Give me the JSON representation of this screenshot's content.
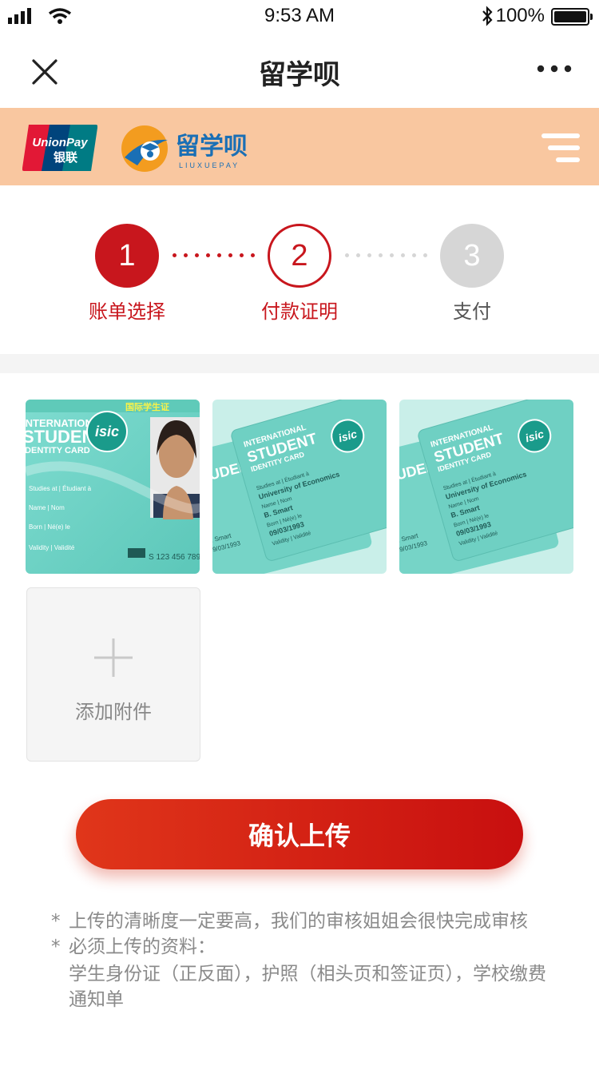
{
  "status_bar": {
    "time": "9:53 AM",
    "battery": "100%",
    "icons": [
      "signal-icon",
      "wifi-icon",
      "bluetooth-icon",
      "battery-icon"
    ]
  },
  "nav": {
    "title": "留学呗",
    "close_icon": "close-icon",
    "more_icon": "more-icon"
  },
  "banner": {
    "color": "#f9c7a0",
    "unionpay_text": "UnionPay",
    "unionpay_cn": "银联",
    "brand_cn": "留学呗",
    "brand_en": "LIUXUEPAY",
    "menu_icon": "menu-icon"
  },
  "steps": [
    {
      "number": "1",
      "label": "账单选择",
      "state": "done"
    },
    {
      "number": "2",
      "label": "付款证明",
      "state": "active"
    },
    {
      "number": "3",
      "label": "支付",
      "state": "pending"
    }
  ],
  "attachments": {
    "images": [
      {
        "alt": "student card front"
      },
      {
        "alt": "student card back"
      },
      {
        "alt": "student card back copy"
      }
    ],
    "card_text": {
      "cn_title": "国际学生证",
      "intl": "INTERNATIONAL",
      "student": "STUDENT",
      "identity": "IDENTITY CARD",
      "isic": "isic",
      "studies": "Studies at | Étudiant à",
      "name": "Name | Nom",
      "born": "Born | Né(e) le",
      "validity": "Validity | Validité",
      "number": "S 123 456 789",
      "university": "University of Economics",
      "holder": "B. Smart",
      "dob": "09/03/1993"
    },
    "add_label": "添加附件"
  },
  "actions": {
    "confirm_label": "确认上传"
  },
  "notes": [
    {
      "star": "*",
      "text": "上传的清晰度一定要高，我们的审核姐姐会很快完成审核"
    },
    {
      "star": "*",
      "text": "必须上传的资料：",
      "detail": "学生身份证（正反面），护照（相头页和签证页），学校缴费通知单"
    }
  ],
  "colors": {
    "accent": "#c8161d",
    "pending": "#d6d6d6",
    "card": "#6fd3c7"
  }
}
